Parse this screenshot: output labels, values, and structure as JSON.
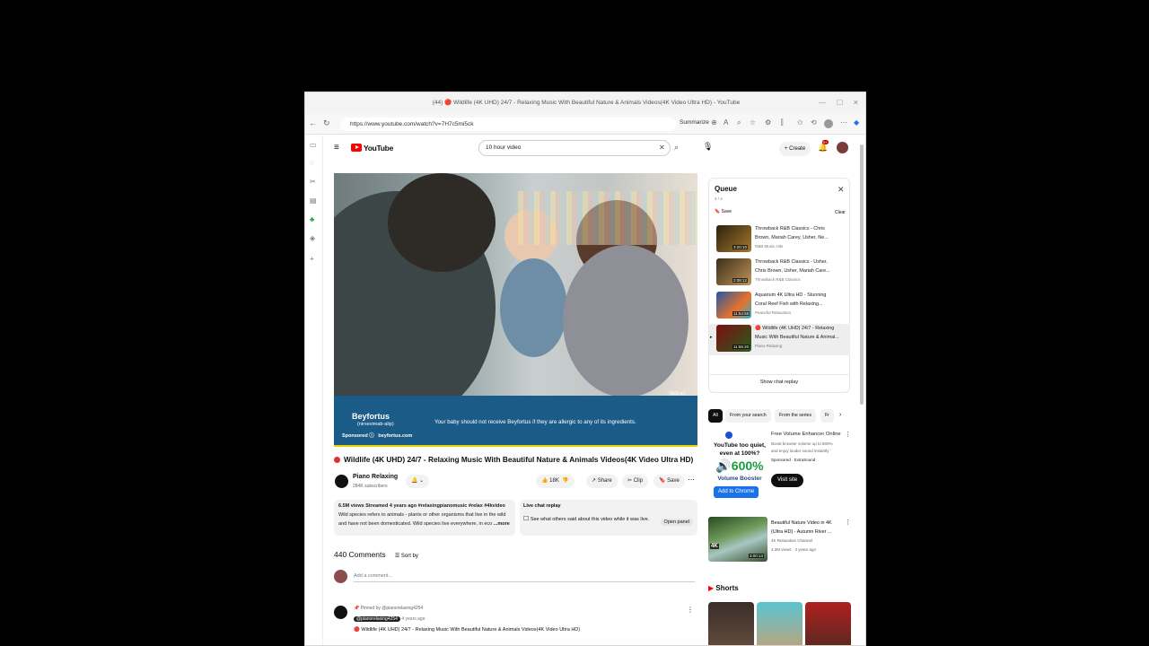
{
  "browser": {
    "title": "(44) 🔴 Wildlife (4K UHD) 24/7 - Relaxing Music With Beautiful Nature & Animals Videos(4K Video Ultra HD) - YouTube",
    "url": "https://www.youtube.com/watch?v=7H7c5mi5ck",
    "summarize_label": "Summarize"
  },
  "header": {
    "logo": "YouTube",
    "search_value": "10 hour video",
    "create_label": "Create",
    "notif_count": "9+"
  },
  "ad": {
    "brand": "Beyfortus",
    "brand_sub": "(nirsevimab-alip)",
    "sponsored": "Sponsored",
    "site": "beyfortus.com",
    "text": "Your baby should not receive Beyfortus if they are allergic to any of its ingredients.",
    "skip": "Skip ▸|"
  },
  "video": {
    "title": "Wildlife (4K UHD) 24/7 - Relaxing Music With Beautiful Nature & Animals Videos(4K Video Ultra HD)",
    "channel": "Piano Relaxing",
    "subs": "284K subscribers",
    "likes": "18K",
    "share": "Share",
    "clip": "Clip",
    "save": "Save",
    "desc_meta": "6.5M views  Streamed 4 years ago  #relaxingpianomusic #relax #4kvideo",
    "desc_line1": "Wild species refers to animals - plants or other organisms that live in the wild",
    "desc_line2": "and have not been domesticated. Wild species live everywhere, in eco",
    "desc_more": "...more",
    "live_title": "Live chat replay",
    "live_text": "See what others said about this video while it was live.",
    "open_panel": "Open panel"
  },
  "comments": {
    "count": "440 Comments",
    "sort": "Sort by",
    "placeholder": "Add a comment...",
    "pinned": "Pinned by @pianorelaxing4254",
    "author": "@pianorelaxing4254",
    "age": "4 years ago",
    "text": "Wildlife (4K UHD) 24/7 - Relaxing Music With Beautiful Nature & Animals Videos(4K Video Ultra HD)"
  },
  "queue": {
    "title": "Queue",
    "count": "4 / 4",
    "save": "Save",
    "clear": "Clear",
    "items": [
      {
        "title1": "Throwback R&B Classics - Chris",
        "title2": "Brown, Mariah Carey, Usher, Ne...",
        "channel": "R&B Music Hits",
        "dur": "3:20:10"
      },
      {
        "title1": "Throwback R&B Classics - Usher,",
        "title2": "Chris Brown, Usher, Mariah Care...",
        "channel": "Throwback R&B Classics",
        "dur": "2:08:12"
      },
      {
        "title1": "Aquarium 4K Ultra HD - Stunning",
        "title2": "Coral Reef Fish with Relaxing...",
        "channel": "Peaceful Relaxation",
        "dur": "11:54:58"
      },
      {
        "title1": "🔴 Wildlife (4K UHD) 24/7 - Relaxing",
        "title2": "Music With Beautiful Nature & Animal...",
        "channel": "Piano Relaxing",
        "dur": "11:55:20"
      }
    ],
    "chat_replay": "Show chat replay"
  },
  "chips": [
    "All",
    "From your search",
    "From the series",
    "Fr"
  ],
  "sidead": {
    "headline1": "YouTube too quiet,",
    "headline2": "even at 100%?",
    "big": "🔊600%",
    "sub": "Volume Booster",
    "cta": "Add to Chrome",
    "title": "Free Volume Enhancer Online",
    "desc1": "Boost browser volume up to 600%",
    "desc2": "and enjoy louder sound instantly",
    "sponsored": "Sponsored · ExtraSound",
    "visit": "Visit site"
  },
  "rec": {
    "title1": "Beautiful Nature Video in 4K",
    "title2": "(Ultra HD) - Autumn River ...",
    "channel": "4K Relaxation Channel",
    "meta": "4.3M views · 3 years ago",
    "dur": "3:00:13",
    "badge": "4K"
  },
  "shorts": {
    "label": "Shorts"
  }
}
